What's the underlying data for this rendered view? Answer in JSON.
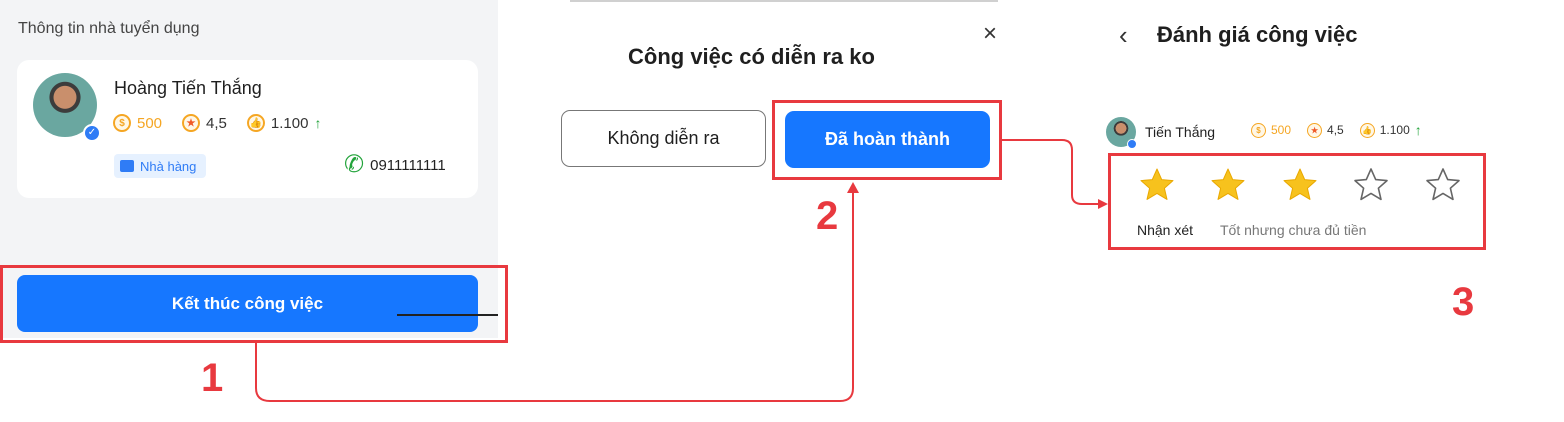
{
  "panel1": {
    "section_title": "Thông tin nhà tuyển dụng",
    "recruiter": {
      "name": "Hoàng Tiến Thắng",
      "coins": "500",
      "rating": "4,5",
      "likes": "1.100",
      "category": "Nhà hàng",
      "phone": "0911111111"
    },
    "end_button": "Kết thúc công việc"
  },
  "panel2": {
    "title": "Công việc có diễn ra ko",
    "close_icon": "×",
    "not_happened_button": "Không diễn ra",
    "completed_button": "Đã hoàn thành"
  },
  "panel3": {
    "back_icon": "‹",
    "title": "Đánh giá công việc",
    "user": {
      "name": "Tiến Thắng",
      "coins": "500",
      "rating": "4,5",
      "likes": "1.100"
    },
    "stars_filled": 3,
    "stars_total": 5,
    "review_label": "Nhận xét",
    "review_text": "Tốt nhưng chưa đủ tiền"
  },
  "steps": [
    "1",
    "2",
    "3"
  ],
  "colors": {
    "primary": "#1677ff",
    "highlight": "#e8393f",
    "star": "#f7c21d",
    "coin": "#f5a623",
    "success": "#22a33a"
  }
}
